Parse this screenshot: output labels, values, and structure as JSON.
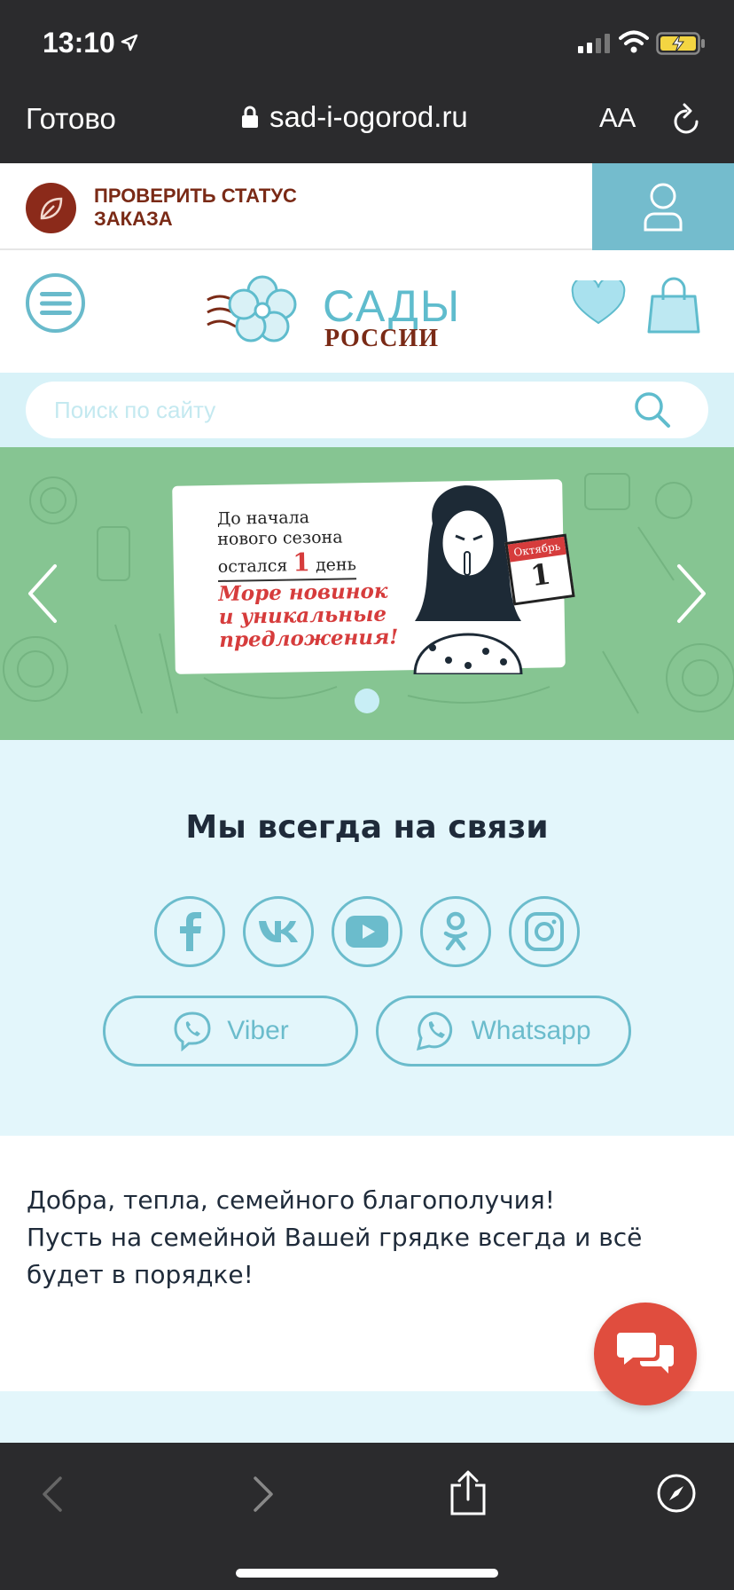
{
  "status_bar": {
    "time": "13:10"
  },
  "browser": {
    "done_label": "Готово",
    "url": "sad-i-ogorod.ru",
    "text_size_label": "AA"
  },
  "header": {
    "order_status_label": "ПРОВЕРИТЬ СТАТУС ЗАКАЗА"
  },
  "logo": {
    "line1": "САДЫ",
    "line2": "РОССИИ"
  },
  "search": {
    "placeholder": "Поиск по сайту"
  },
  "banner": {
    "line1": "До начала",
    "line2": "нового сезона",
    "line3_prefix": "остался",
    "line3_number": "1",
    "line3_suffix": "день",
    "promo": "Море новинок и уникальные предложения!",
    "calendar_month": "Октябрь",
    "calendar_day": "1"
  },
  "contacts": {
    "title": "Мы всегда на связи",
    "socials": [
      "facebook-icon",
      "vk-icon",
      "youtube-icon",
      "odnoklassniki-icon",
      "instagram-icon"
    ],
    "viber_label": "Viber",
    "whatsapp_label": "Whatsapp"
  },
  "message": {
    "line1": "Добра, тепла, семейного благополучия!",
    "line2": "Пусть на семейной Вашей грядке всегда и всё будет в порядке!"
  },
  "colors": {
    "accent": "#6bbccc",
    "brand_brown": "#7a2a16",
    "chat_red": "#e04d3e",
    "banner_green": "#86c592"
  }
}
